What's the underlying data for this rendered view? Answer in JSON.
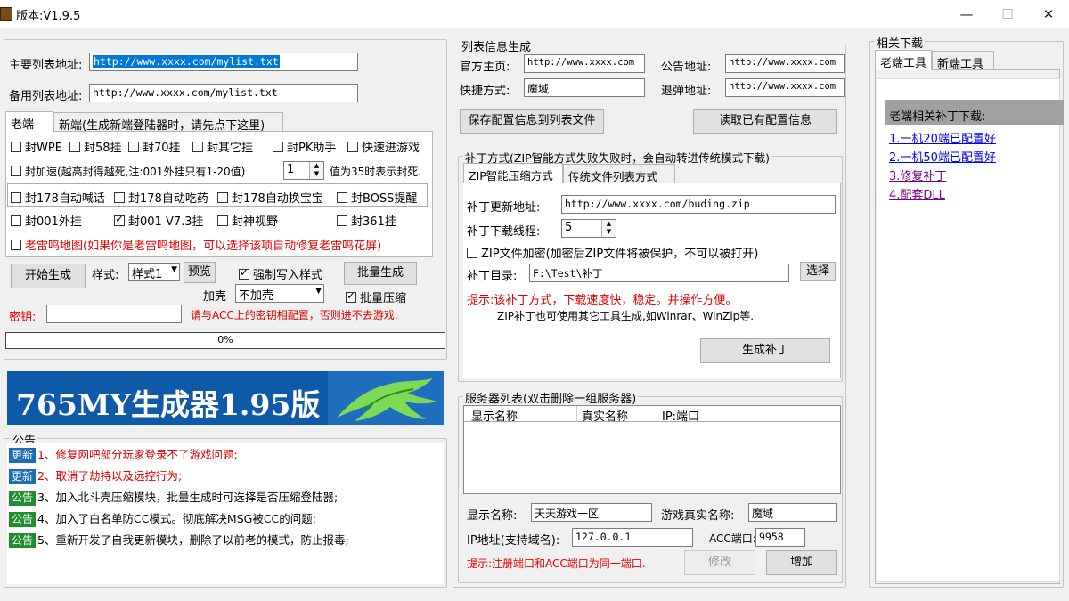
{
  "window": {
    "title": "版本:V1.9.5",
    "minimize": "—",
    "maximize": "☐",
    "close": "✕"
  },
  "left": {
    "main_list_label": "主要列表地址:",
    "main_list_value": "http://www.xxxx.com/mylist.txt",
    "backup_list_label": "备用列表地址:",
    "backup_list_value": "http://www.xxxx.com/mylist.txt",
    "tabs": [
      "老端",
      "新端(生成新端登陆器时，请先点下这里)"
    ],
    "checks": {
      "wpe": "封WPE",
      "c58": "封58挂",
      "c70": "封70挂",
      "other": "封其它挂",
      "pk": "封PK助手",
      "quick": "快速进游戏",
      "speed": "封加速(越高封得越死,注:001外挂只有1-20值)",
      "speed_value": "1",
      "speed_note": "值为35时表示封死.",
      "shout": "封178自动喊话",
      "eat": "封178自动吃药",
      "swap": "封178自动换宝宝",
      "boss": "封BOSS提醒",
      "c001": "封001外挂",
      "c001v": "封001 V7.3挂",
      "vision": "封神视野",
      "c361": "封361挂",
      "map": "老雷鸣地图(如果你是老雷鸣地图，可以选择该项自动修复老雷鸣花屏)"
    },
    "start_button": "开始生成",
    "style_label": "样式:",
    "style_value": "样式1",
    "preview_button": "预览",
    "force_write": "强制写入样式",
    "batch_button": "批量生成",
    "shell_label": "加壳",
    "shell_value": "不加壳",
    "batch_compress": "批量压缩",
    "key_label": "密钥:",
    "key_value": "",
    "key_note": "请与ACC上的密钥相配置，否则进不去游戏.",
    "progress_text": "0%",
    "progress_value": 0,
    "banner_text": "765MY生成器1.95版",
    "notice_title": "公告",
    "notices": [
      {
        "badge": "更新",
        "badge_color": "#1c6bb5",
        "text": "1、修复网吧部分玩家登录不了游戏问题;",
        "red": true
      },
      {
        "badge": "更新",
        "badge_color": "#1c6bb5",
        "text": "2、取消了劫持以及远控行为;",
        "red": true
      },
      {
        "badge": "公告",
        "badge_color": "#1e8e2e",
        "text": "3、加入北斗壳压缩模块，批量生成时可选择是否压缩登陆器;",
        "red": false
      },
      {
        "badge": "公告",
        "badge_color": "#1e8e2e",
        "text": "4、加入了白名单防CC模式。彻底解决MSG被CC的问题;",
        "red": false
      },
      {
        "badge": "公告",
        "badge_color": "#1e8e2e",
        "text": "5、重新开发了自我更新模块，删除了以前老的模式，防止报毒;",
        "red": false
      }
    ]
  },
  "middle": {
    "info_title": "列表信息生成",
    "official_label": "官方主页:",
    "official_value": "http://www.xxxx.com",
    "notice_label": "公告地址:",
    "notice_value": "http://www.xxxx.com",
    "shortcut_label": "快捷方式:",
    "shortcut_value": "魔域",
    "popup_label": "退弹地址:",
    "popup_value": "http://www.xxxx.com",
    "save_button": "保存配置信息到列表文件",
    "read_button": "读取已有配置信息",
    "patch_title": "补丁方式(ZIP智能方式失败失败时，会自动转进传统模式下载)",
    "patch_tabs": [
      "ZIP智能压缩方式",
      "传统文件列表方式"
    ],
    "patch_url_label": "补丁更新地址:",
    "patch_url_value": "http://www.xxxx.com/buding.zip",
    "threads_label": "补丁下载线程:",
    "threads_value": "5",
    "zip_encrypt": "ZIP文件加密(加密后ZIP文件将被保护，不可以被打开)",
    "patch_dir_label": "补丁目录:",
    "patch_dir_value": "F:\\Test\\补丁",
    "browse_button": "选择",
    "tip1": "提示:该补丁方式，下载速度快，稳定。并操作方便。",
    "tip2": "ZIP补丁也可使用其它工具生成,如Winrar、WinZip等.",
    "gen_patch_button": "生成补丁",
    "server_title": "服务器列表(双击删除一组服务器)",
    "columns": [
      "显示名称",
      "真实名称",
      "IP:端口"
    ],
    "display_label": "显示名称:",
    "display_value": "天天游戏一区",
    "real_label": "游戏真实名称:",
    "real_value": "魔域",
    "ip_label": "IP地址(支持域名):",
    "ip_value": "127.0.0.1",
    "acc_label": "ACC端口:",
    "acc_value": "9958",
    "server_tip": "提示:注册端口和ACC端口为同一端口.",
    "modify_button": "修改",
    "add_button": "增加"
  },
  "right": {
    "title": "相关下载",
    "tabs": [
      "老端工具",
      "新端工具"
    ],
    "section": "老端相关补丁下载:",
    "links": [
      {
        "text": "1.一机20端已配置好",
        "color": "#0000ee"
      },
      {
        "text": "2.一机50端已配置好",
        "color": "#0000ee"
      },
      {
        "text": "3.修复补丁",
        "color": "#800080"
      },
      {
        "text": "4.配套DLL",
        "color": "#800080"
      }
    ]
  }
}
